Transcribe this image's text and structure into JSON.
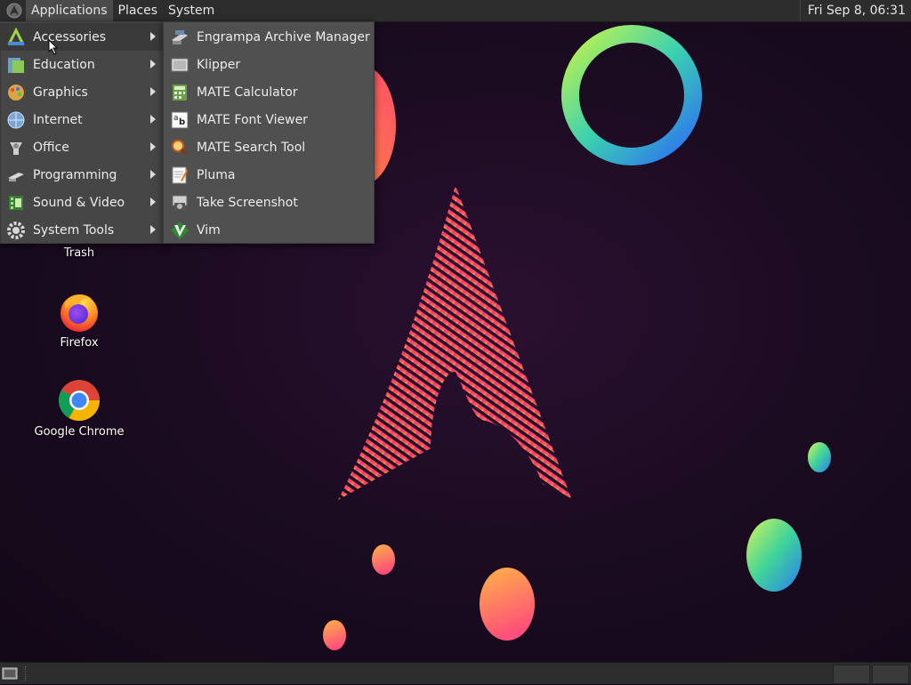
{
  "top_panel": {
    "menus": [
      "Applications",
      "Places",
      "System"
    ],
    "clock": "Fri Sep  8, 06:31"
  },
  "main_menu": {
    "items": [
      {
        "label": "Accessories",
        "icon": "accessories-icon"
      },
      {
        "label": "Education",
        "icon": "education-icon"
      },
      {
        "label": "Graphics",
        "icon": "graphics-icon"
      },
      {
        "label": "Internet",
        "icon": "internet-icon"
      },
      {
        "label": "Office",
        "icon": "office-icon"
      },
      {
        "label": "Programming",
        "icon": "programming-icon"
      },
      {
        "label": "Sound & Video",
        "icon": "sound-video-icon"
      },
      {
        "label": "System Tools",
        "icon": "system-tools-icon"
      }
    ]
  },
  "sub_menu": {
    "items": [
      {
        "label": "Engrampa Archive Manager",
        "icon": "archive-manager-icon"
      },
      {
        "label": "Klipper",
        "icon": "clipboard-icon"
      },
      {
        "label": "MATE Calculator",
        "icon": "calculator-icon"
      },
      {
        "label": "MATE Font Viewer",
        "icon": "font-viewer-icon"
      },
      {
        "label": "MATE Search Tool",
        "icon": "search-tool-icon"
      },
      {
        "label": "Pluma",
        "icon": "text-editor-icon"
      },
      {
        "label": "Take Screenshot",
        "icon": "screenshot-icon"
      },
      {
        "label": "Vim",
        "icon": "vim-icon"
      }
    ]
  },
  "desktop_icons": [
    {
      "label": "Trash",
      "icon": "trash-icon"
    },
    {
      "label": "Firefox",
      "icon": "firefox-icon"
    },
    {
      "label": "Google Chrome",
      "icon": "chrome-icon"
    }
  ],
  "colors": {
    "panel": "#2d2d2d",
    "menu": "#464646",
    "submenu": "#505050",
    "highlight": "#3a3a3a"
  }
}
